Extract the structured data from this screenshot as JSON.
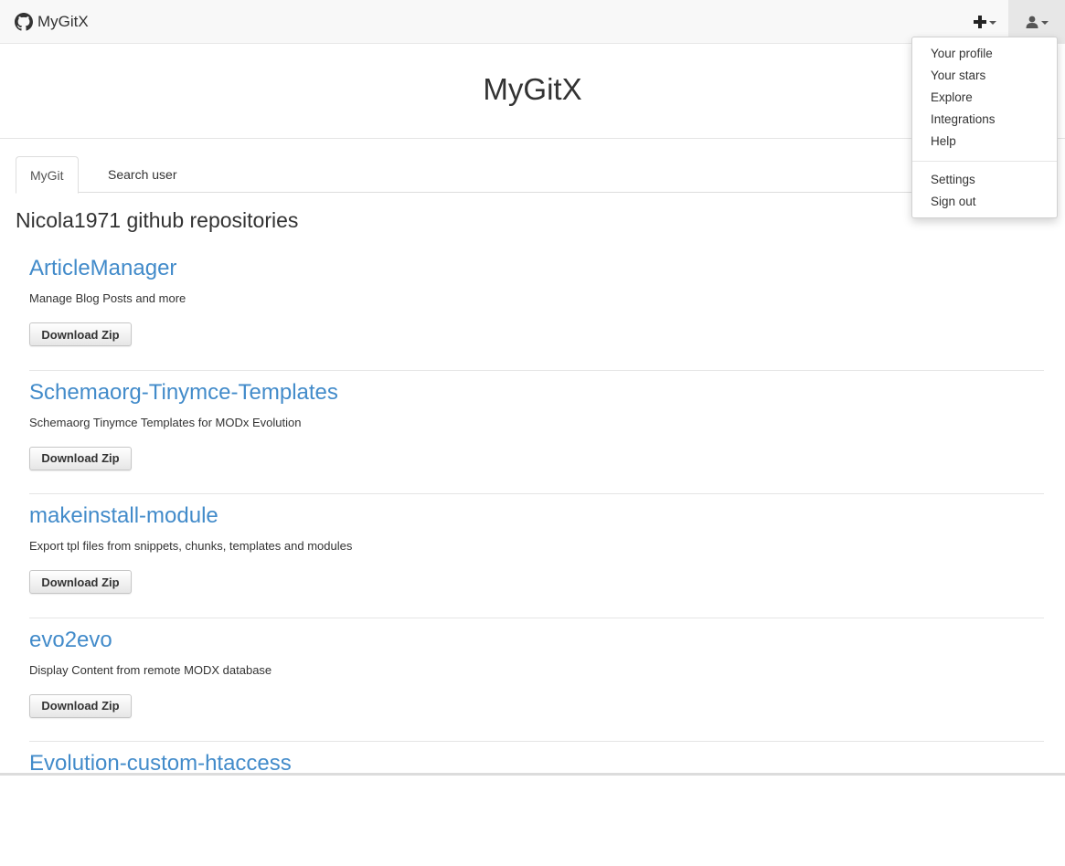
{
  "navbar": {
    "brand": "MyGitX",
    "plus_icon": "plus-icon",
    "user_icon": "user-icon"
  },
  "header": {
    "title": "MyGitX"
  },
  "tabs": [
    {
      "label": "MyGit",
      "active": true
    },
    {
      "label": "Search user",
      "active": false
    }
  ],
  "main": {
    "heading": "Nicola1971 github repositories",
    "repos": [
      {
        "name": "ArticleManager",
        "description": "Manage Blog Posts and more",
        "button": "Download Zip"
      },
      {
        "name": "Schemaorg-Tinymce-Templates",
        "description": "Schemaorg Tinymce Templates for MODx Evolution",
        "button": "Download Zip"
      },
      {
        "name": "makeinstall-module",
        "description": "Export tpl files from snippets, chunks, templates and modules",
        "button": "Download Zip"
      },
      {
        "name": "evo2evo",
        "description": "Display Content from remote MODX database",
        "button": "Download Zip"
      },
      {
        "name": "Evolution-custom-htaccess",
        "description": "",
        "button": ""
      }
    ]
  },
  "user_menu": {
    "group1": [
      "Your profile",
      "Your stars",
      "Explore",
      "Integrations",
      "Help"
    ],
    "group2": [
      "Settings",
      "Sign out"
    ]
  },
  "colors": {
    "link": "#428bca",
    "navbar_bg": "#f8f8f8",
    "active_nav_bg": "#e7e7e7"
  }
}
